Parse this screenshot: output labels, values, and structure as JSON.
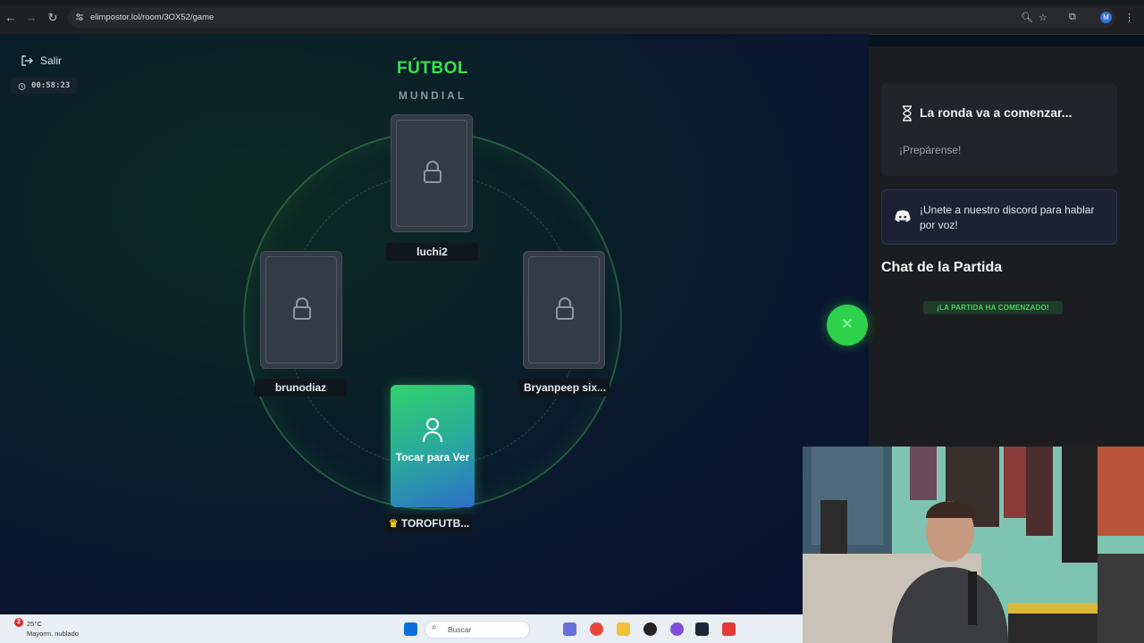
{
  "browser": {
    "url": "elimpostor.lol/room/3OX52/game",
    "profile_initial": "M"
  },
  "game": {
    "exit_label": "Salir",
    "timer": "00:58:23",
    "category": "FÚTBOL",
    "subcategory": "MUNDIAL",
    "players": [
      {
        "name": "luchi2",
        "locked": true
      },
      {
        "name": "brunodiaz",
        "locked": true
      },
      {
        "name": "Bryanpeep six...",
        "locked": true
      }
    ],
    "me": {
      "name": "TOROFUTB...",
      "tap_label": "Tocar para Ver",
      "host": true
    },
    "colors": {
      "accent": "#3be04f",
      "card": "#323b46"
    }
  },
  "panel": {
    "round_title": "La ronda va a comenzar...",
    "round_subtitle": "¡Prepárense!",
    "discord_text": "¡Unete a nuestro discord para hablar por voz!",
    "chat_title": "Chat de la Partida",
    "chat_badge": "¡LA PARTIDA HA COMENZADO!"
  },
  "taskbar": {
    "notification_count": "2",
    "temperature": "25°C",
    "weather": "Mayorm. nublado",
    "search_placeholder": "Buscar"
  }
}
